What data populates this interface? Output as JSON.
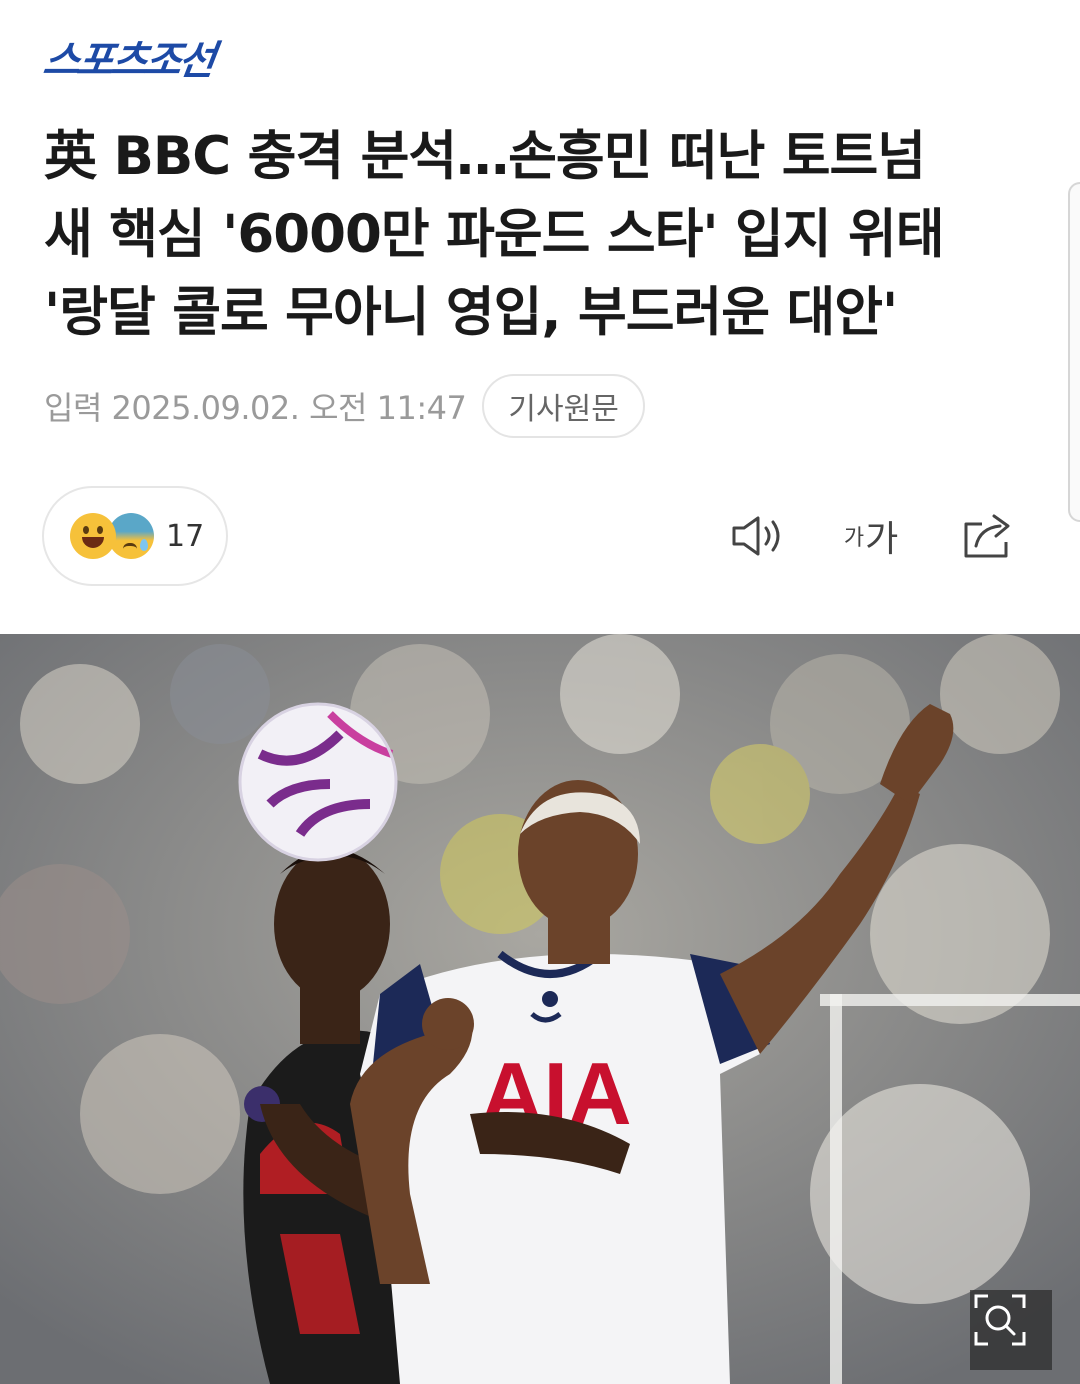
{
  "header": {
    "logo_text": "스포츠조선"
  },
  "article": {
    "title_lines": [
      "英 BBC 충격 분석…손흥민 떠난 토트넘",
      "새 핵심 '6000만 파운드 스타' 입지 위태",
      "'랑달 콜로 무아니 영입, 부드러운 대안'"
    ],
    "date": "입력 2025.09.02. 오전 11:47",
    "source_button": "기사원문"
  },
  "reactions": {
    "icons": [
      "grinning-face-icon",
      "sad-sweat-face-icon"
    ],
    "count": "17"
  },
  "toolbar": {
    "speaker_icon": "speaker-icon",
    "font_size_label_small": "가",
    "font_size_label_large": "가",
    "share_icon": "share-icon"
  },
  "photo": {
    "jersey_sponsor": "AIA",
    "zoom_icon": "zoom-search-icon"
  },
  "colors": {
    "logo": "#1d4aa6",
    "title": "#1a1a1a",
    "meta": "#9a9a9a",
    "border": "#e4e4e4",
    "jersey_sponsor": "#c8102e"
  }
}
